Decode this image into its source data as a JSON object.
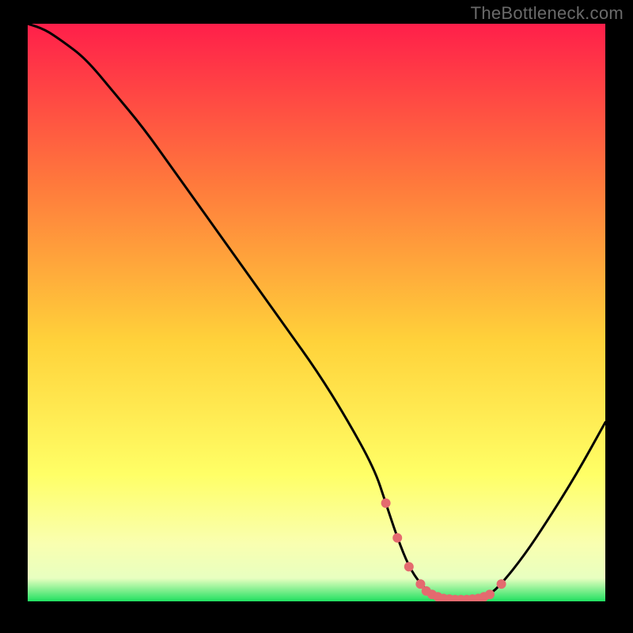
{
  "watermark": "TheBottleneck.com",
  "colors": {
    "bg": "#000000",
    "grad_top": "#ff1f4a",
    "grad_mid_upper": "#ff7a3c",
    "grad_mid": "#ffd23a",
    "grad_low": "#ffff66",
    "grad_pale": "#f9ffb0",
    "grad_green": "#20e060",
    "curve": "#000000",
    "dots": "#e46a6f"
  },
  "chart_data": {
    "type": "line",
    "title": "",
    "xlabel": "",
    "ylabel": "",
    "xlim": [
      0,
      100
    ],
    "ylim": [
      0,
      100
    ],
    "series": [
      {
        "name": "bottleneck-curve",
        "x": [
          0,
          3,
          6,
          10,
          15,
          20,
          25,
          30,
          35,
          40,
          45,
          50,
          55,
          60,
          62,
          64,
          66,
          68,
          70,
          72,
          74,
          76,
          78,
          80,
          82,
          86,
          90,
          95,
          100
        ],
        "values": [
          100,
          99,
          97,
          94,
          88,
          82,
          75,
          68,
          61,
          54,
          47,
          40,
          32,
          23,
          17,
          11,
          6,
          3,
          1.2,
          0.5,
          0.3,
          0.3,
          0.5,
          1.2,
          3,
          8,
          14,
          22,
          31
        ]
      }
    ],
    "markers": {
      "name": "highlight-dots",
      "x": [
        62,
        64,
        66,
        68,
        69,
        70,
        71,
        72,
        73,
        74,
        75,
        76,
        77,
        78,
        79,
        80,
        82
      ],
      "values": [
        17,
        11,
        6,
        3,
        1.8,
        1.2,
        0.8,
        0.5,
        0.4,
        0.3,
        0.3,
        0.3,
        0.4,
        0.5,
        0.8,
        1.2,
        3
      ]
    }
  }
}
